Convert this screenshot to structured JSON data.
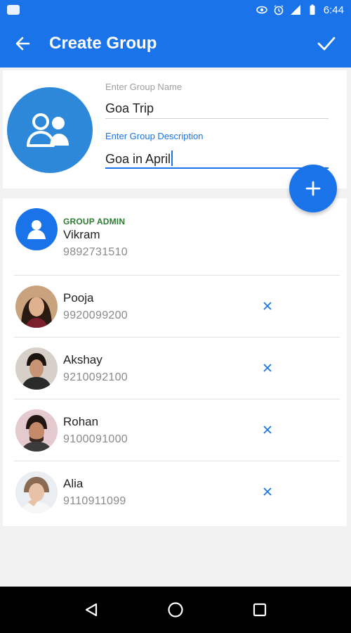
{
  "status_bar": {
    "time": "6:44"
  },
  "app_bar": {
    "title": "Create Group",
    "back_icon": "arrow-back-icon",
    "done_icon": "check-icon"
  },
  "group": {
    "name_label": "Enter Group Name",
    "name_value": "Goa Trip",
    "description_label": "Enter Group Description",
    "description_value": "Goa in April"
  },
  "members": [
    {
      "role": "GROUP ADMIN",
      "name": "Vikram",
      "phone": "9892731510",
      "removable": false
    },
    {
      "role": "",
      "name": "Pooja",
      "phone": "9920099200",
      "removable": true
    },
    {
      "role": "",
      "name": "Akshay",
      "phone": "9210092100",
      "removable": true
    },
    {
      "role": "",
      "name": "Rohan",
      "phone": "9100091000",
      "removable": true
    },
    {
      "role": "",
      "name": "Alia",
      "phone": "9110911099",
      "removable": true
    }
  ],
  "colors": {
    "primary": "#1a73e8",
    "admin_tag": "#2e7d32",
    "avatar_bg": "#2d88da"
  }
}
